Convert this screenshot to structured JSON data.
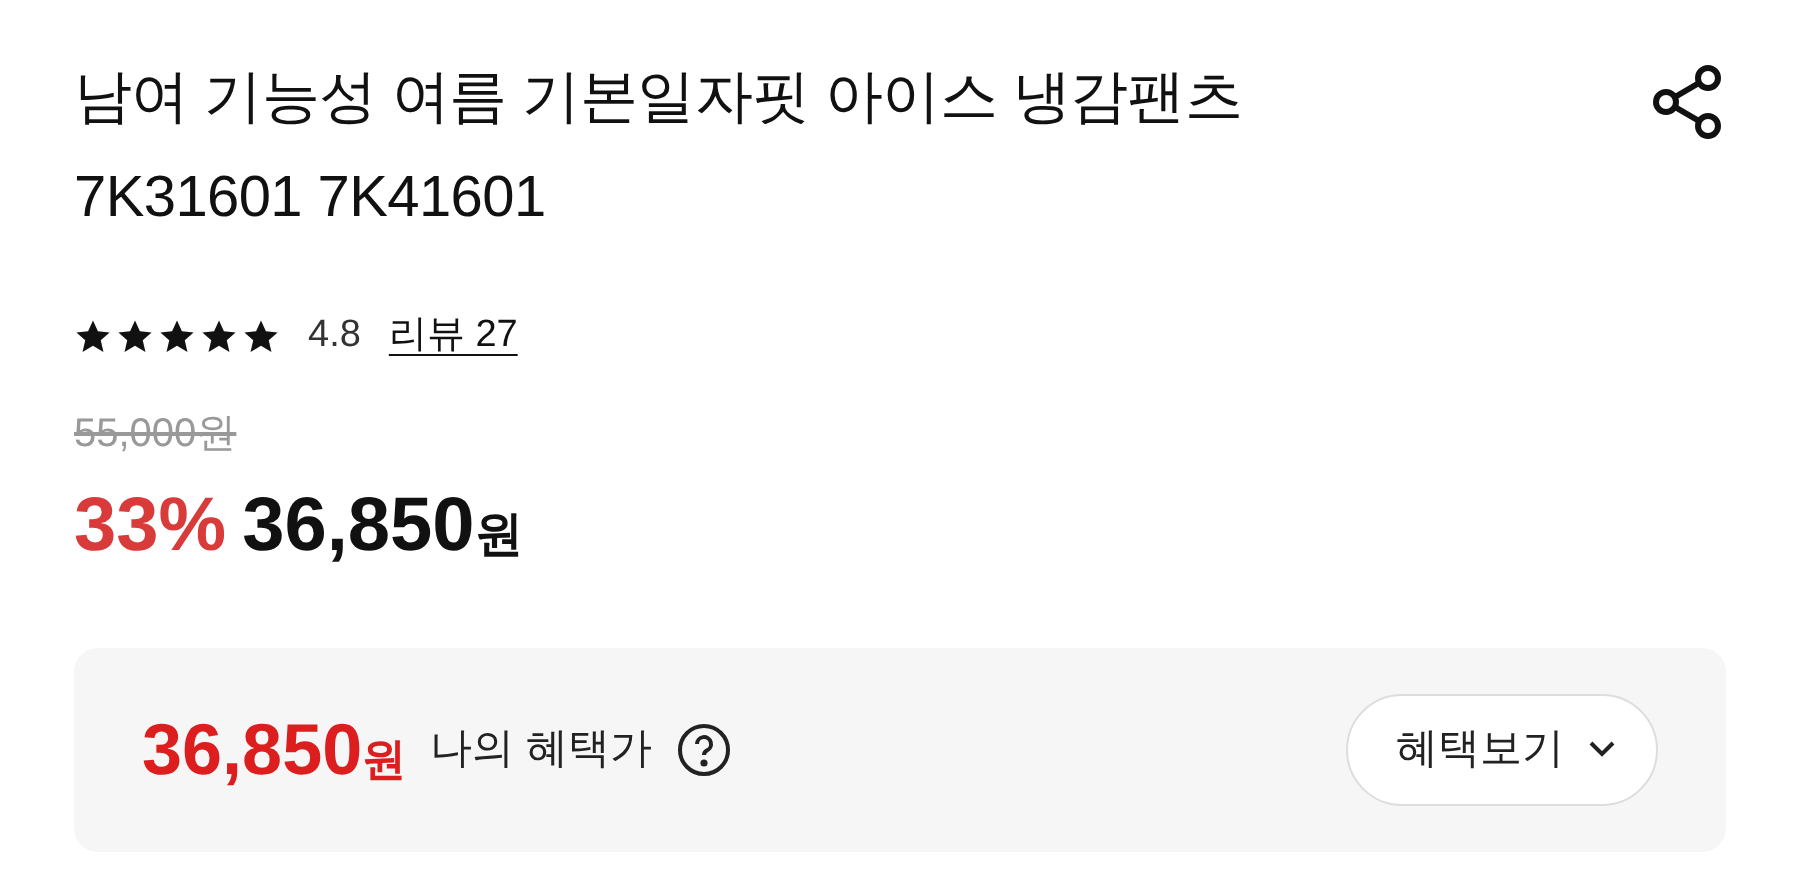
{
  "product": {
    "title": "남여 기능성 여름 기본일자핏 아이스 냉감팬츠 7K31601 7K41601"
  },
  "rating": {
    "stars": 5,
    "score": "4.8",
    "review_link": "리뷰 27"
  },
  "price": {
    "original": "55,000원",
    "discount": "33%",
    "sale_amount": "36,850",
    "sale_unit": "원"
  },
  "benefit": {
    "amount": "36,850",
    "unit": "원",
    "label": "나의 혜택가",
    "button": "혜택보기"
  }
}
